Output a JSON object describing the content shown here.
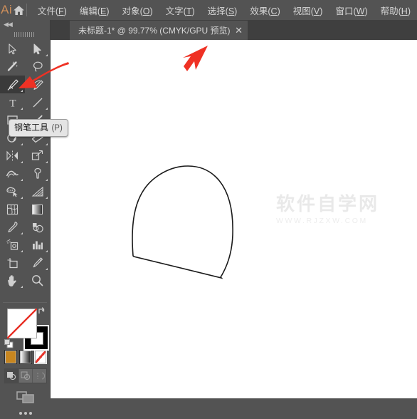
{
  "app": {
    "logo_text": "Ai",
    "home_icon": "home-icon",
    "background_color": "#535353",
    "canvas_color": "#ffffff",
    "accent_color": "#cf8f5a"
  },
  "menubar": {
    "items": [
      {
        "label": "文件",
        "mnemonic": "F"
      },
      {
        "label": "编辑",
        "mnemonic": "E"
      },
      {
        "label": "对象",
        "mnemonic": "O"
      },
      {
        "label": "文字",
        "mnemonic": "T"
      },
      {
        "label": "选择",
        "mnemonic": "S"
      },
      {
        "label": "效果",
        "mnemonic": "C"
      },
      {
        "label": "视图",
        "mnemonic": "V"
      },
      {
        "label": "窗口",
        "mnemonic": "W"
      },
      {
        "label": "帮助",
        "mnemonic": "H"
      }
    ]
  },
  "tabstrip": {
    "tab_title": "未标题-1* @ 99.77% (CMYK/GPU 预览)",
    "close_label": "✕"
  },
  "toolpanel": {
    "collapse_label": "◀◀",
    "tools": [
      {
        "row": 1,
        "left": {
          "name": "selection-tool",
          "has_corner": false
        },
        "right": {
          "name": "direct-selection-tool",
          "has_corner": true
        }
      },
      {
        "row": 2,
        "left": {
          "name": "magic-wand-tool",
          "has_corner": false
        },
        "right": {
          "name": "lasso-tool",
          "has_corner": false
        }
      },
      {
        "row": 3,
        "left": {
          "name": "pen-tool",
          "has_corner": true,
          "active": true
        },
        "right": {
          "name": "curvature-tool",
          "has_corner": false
        }
      },
      {
        "row": 4,
        "left": {
          "name": "type-tool",
          "has_corner": true
        },
        "right": {
          "name": "line-segment-tool",
          "has_corner": true
        }
      },
      {
        "row": 5,
        "left": {
          "name": "rectangle-tool",
          "has_corner": true
        },
        "right": {
          "name": "paintbrush-tool",
          "has_corner": true
        }
      },
      {
        "row": 6,
        "left": {
          "name": "shaper-tool",
          "has_corner": true
        },
        "right": {
          "name": "eraser-tool",
          "has_corner": true
        }
      },
      {
        "row": 7,
        "left": {
          "name": "reflect-tool",
          "has_corner": true
        },
        "right": {
          "name": "scale-tool",
          "has_corner": true
        }
      },
      {
        "row": 8,
        "left": {
          "name": "width-tool",
          "has_corner": true
        },
        "right": {
          "name": "free-transform-tool",
          "has_corner": true
        }
      },
      {
        "row": 9,
        "left": {
          "name": "shape-builder-tool",
          "has_corner": true
        },
        "right": {
          "name": "perspective-grid-tool",
          "has_corner": true
        }
      },
      {
        "row": 10,
        "left": {
          "name": "mesh-tool",
          "has_corner": false
        },
        "right": {
          "name": "gradient-tool",
          "has_corner": false
        }
      },
      {
        "row": 11,
        "left": {
          "name": "eyedropper-tool",
          "has_corner": true
        },
        "right": {
          "name": "blend-tool",
          "has_corner": false
        }
      },
      {
        "row": 12,
        "left": {
          "name": "symbol-sprayer-tool",
          "has_corner": true
        },
        "right": {
          "name": "column-graph-tool",
          "has_corner": true
        }
      },
      {
        "row": 13,
        "left": {
          "name": "artboard-tool",
          "has_corner": false
        },
        "right": {
          "name": "slice-tool",
          "has_corner": true
        }
      },
      {
        "row": 14,
        "left": {
          "name": "hand-tool",
          "has_corner": true
        },
        "right": {
          "name": "zoom-tool",
          "has_corner": false
        }
      }
    ],
    "tooltip": {
      "name": "钢笔工具",
      "shortcut": "(P)"
    },
    "color": {
      "fill_label": "无",
      "fill_color": "none",
      "stroke_color": "#000000",
      "swatches": [
        {
          "name": "color-swatch",
          "color": "#c8861f",
          "selected": false
        },
        {
          "name": "gradient-swatch",
          "color": "gradient",
          "selected": false
        },
        {
          "name": "none-swatch",
          "color": "none",
          "selected": true
        }
      ],
      "draw_modes": [
        {
          "name": "draw-normal",
          "selected": true
        },
        {
          "name": "draw-behind",
          "selected": false
        },
        {
          "name": "draw-inside",
          "selected": false
        }
      ]
    },
    "screen_mode": "change-screen-mode",
    "more_tools": "more-tools"
  },
  "canvas": {
    "shape_name": "drawn-arch-path",
    "stroke_color": "#1a1a1a",
    "annotation_arrow_color": "#ef3124",
    "watermark_main": "软件自学网",
    "watermark_sub": "WWW.RJZXW.COM"
  }
}
